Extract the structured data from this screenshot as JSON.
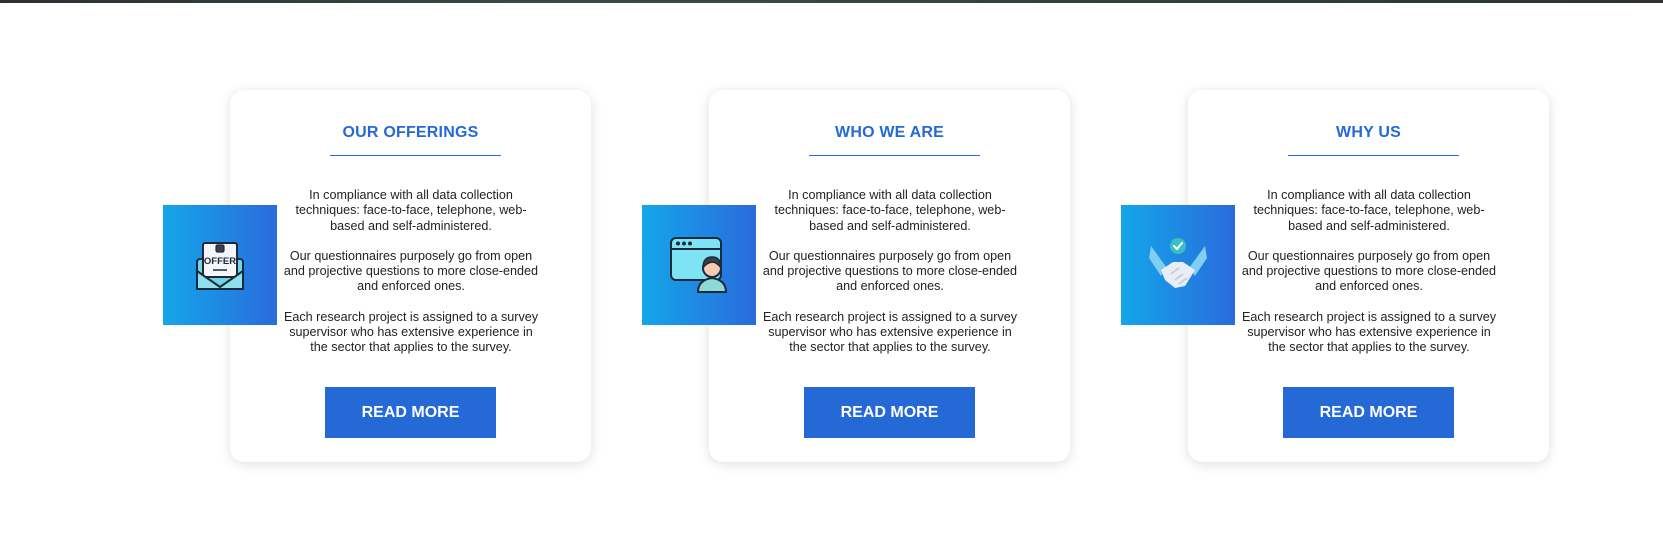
{
  "cards": [
    {
      "title": "OUR OFFERINGS",
      "icon": "offer-envelope-icon",
      "icon_text": "OFFER",
      "paragraphs": [
        "In compliance with all data collection techniques: face-to-face, telephone, web-based and self-administered.",
        "Our questionnaires purposely go from open and projective questions to more close-ended and enforced ones.",
        "Each research project is assigned to a survey supervisor who has extensive experience in the sector that applies to the survey."
      ],
      "button_label": "READ MORE"
    },
    {
      "title": "WHO WE ARE",
      "icon": "person-browser-icon",
      "paragraphs": [
        "In compliance with all data collection techniques: face-to-face, telephone, web-based and self-administered.",
        "Our questionnaires purposely go from open and projective questions to more close-ended and enforced ones.",
        "Each research project is assigned to a survey supervisor who has extensive experience in the sector that applies to the survey."
      ],
      "button_label": "READ MORE"
    },
    {
      "title": "WHY US",
      "icon": "handshake-check-icon",
      "paragraphs": [
        "In compliance with all data collection techniques: face-to-face, telephone, web-based and self-administered.",
        "Our questionnaires purposely go from open and projective questions to more close-ended and enforced ones.",
        "Each research project is assigned to a survey supervisor who has extensive experience in the sector that applies to the survey."
      ],
      "button_label": "READ MORE"
    }
  ],
  "colors": {
    "accent": "#2469d6",
    "tile_gradient_start": "#14a6e9",
    "tile_gradient_end": "#2a6bdc"
  }
}
